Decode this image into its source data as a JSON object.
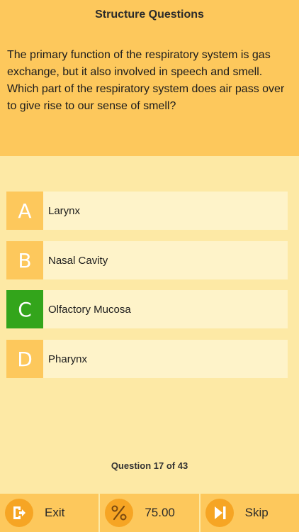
{
  "header": {
    "title": "Structure Questions",
    "question": "The primary function of the respiratory system is gas exchange, but it also involved in speech and smell. Which part of the respiratory system does air pass over to give rise to our sense of smell?"
  },
  "answers": [
    {
      "letter": "A",
      "text": "Larynx",
      "state": "default"
    },
    {
      "letter": "B",
      "text": "Nasal Cavity",
      "state": "default"
    },
    {
      "letter": "C",
      "text": "Olfactory Mucosa",
      "state": "correct"
    },
    {
      "letter": "D",
      "text": "Pharynx",
      "state": "default"
    }
  ],
  "progress": {
    "label": "Question 17 of 43"
  },
  "bottom_bar": {
    "exit_label": "Exit",
    "exit_icon": "exit-icon",
    "score_value": "75.00",
    "score_icon": "percent-icon",
    "skip_label": "Skip",
    "skip_icon": "skip-icon"
  },
  "colors": {
    "header_bg": "#fdc85c",
    "page_bg": "#fde9a5",
    "answer_bg": "#fef3c9",
    "letter_bg": "#fdc85c",
    "correct": "#33a51b",
    "icon_circle": "#f6a524"
  }
}
